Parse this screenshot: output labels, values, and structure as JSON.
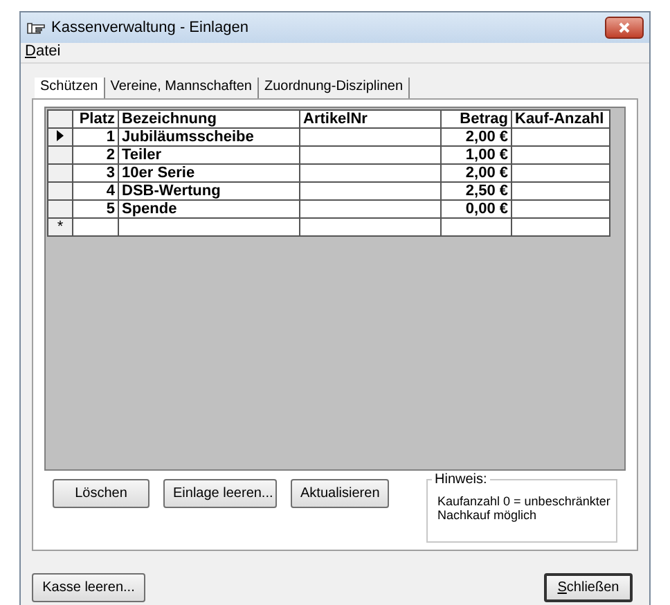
{
  "window": {
    "title": "Kassenverwaltung - Einlagen"
  },
  "menu": [
    {
      "label": "Datei",
      "underline_first": true
    }
  ],
  "tabs": [
    {
      "label": "Schützen",
      "selected": true
    },
    {
      "label": "Vereine, Mannschaften",
      "selected": false
    },
    {
      "label": "Zuordnung-Disziplinen",
      "selected": false
    }
  ],
  "table": {
    "columns": [
      "Platz",
      "Bezeichnung",
      "ArtikelNr",
      "Betrag",
      "Kauf-Anzahl"
    ],
    "rows": [
      {
        "kind": "data",
        "selected": true,
        "cells": [
          "1",
          "Jubiläumsscheibe",
          "",
          "2,00 €",
          ""
        ]
      },
      {
        "kind": "data",
        "selected": false,
        "cells": [
          "2",
          "Teiler",
          "",
          "1,00 €",
          ""
        ]
      },
      {
        "kind": "data",
        "selected": false,
        "cells": [
          "3",
          "10er Serie",
          "",
          "2,00 €",
          ""
        ]
      },
      {
        "kind": "data",
        "selected": false,
        "cells": [
          "4",
          "DSB-Wertung",
          "",
          "2,50 €",
          ""
        ]
      },
      {
        "kind": "data",
        "selected": false,
        "cells": [
          "5",
          "Spende",
          "",
          "0,00 €",
          ""
        ]
      },
      {
        "kind": "new",
        "marker": "*",
        "selected": false,
        "cells": [
          "",
          "",
          "",
          "",
          ""
        ]
      }
    ]
  },
  "panel_buttons": [
    "Löschen",
    "Einlage leeren...",
    "Aktualisieren"
  ],
  "hint": {
    "title": "Hinweis:",
    "text": "Kaufanzahl 0 = unbeschränkter Nachkauf möglich"
  },
  "footer_buttons": [
    {
      "label": "Kasse leeren...",
      "default": false,
      "underline_first": false
    },
    {
      "label": "Schließen",
      "default": true,
      "underline_first": true
    }
  ]
}
